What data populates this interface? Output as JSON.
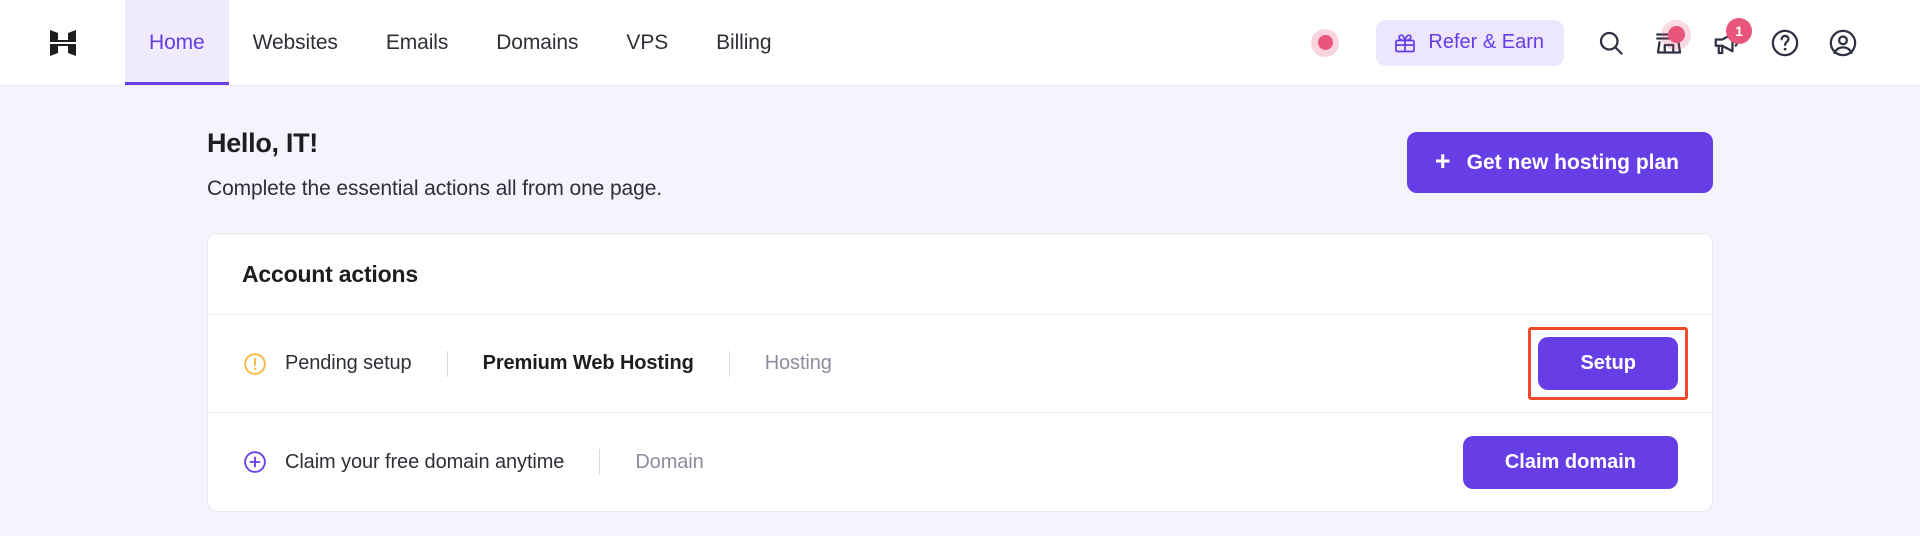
{
  "brand": {
    "logo_name": "hostinger-logo",
    "accent": "#673de6",
    "accent_soft": "#ece7fd",
    "page_bg": "#f4f4fc",
    "badge_pink": "#e8567c",
    "warning_amber": "#f5b73d",
    "annotation_red": "#f04a2b"
  },
  "header": {
    "nav": [
      {
        "label": "Home",
        "active": true
      },
      {
        "label": "Websites",
        "active": false
      },
      {
        "label": "Emails",
        "active": false
      },
      {
        "label": "Domains",
        "active": false
      },
      {
        "label": "VPS",
        "active": false
      },
      {
        "label": "Billing",
        "active": false
      }
    ],
    "status_indicator": "recording-dot",
    "refer": {
      "label": "Refer & Earn",
      "icon": "gift-icon"
    },
    "icons": [
      {
        "name": "search-icon",
        "badge": null
      },
      {
        "name": "store-icon",
        "badge": "dot"
      },
      {
        "name": "megaphone-icon",
        "badge": "1"
      },
      {
        "name": "help-circle-icon",
        "badge": null
      },
      {
        "name": "account-avatar-icon",
        "badge": null
      }
    ]
  },
  "page": {
    "greeting": "Hello, IT!",
    "subtitle": "Complete the essential actions all from one page.",
    "cta": {
      "label": "Get new hosting plan",
      "icon": "plus-icon"
    }
  },
  "card": {
    "title": "Account actions",
    "rows": [
      {
        "icon": "warning-circle-icon",
        "status": "Pending setup",
        "product": "Premium Web Hosting",
        "category": "Hosting",
        "action_label": "Setup",
        "highlighted": true
      },
      {
        "icon": "plus-circle-icon",
        "status": "Claim your free domain anytime",
        "product": "",
        "category": "Domain",
        "action_label": "Claim domain",
        "highlighted": false
      }
    ]
  }
}
